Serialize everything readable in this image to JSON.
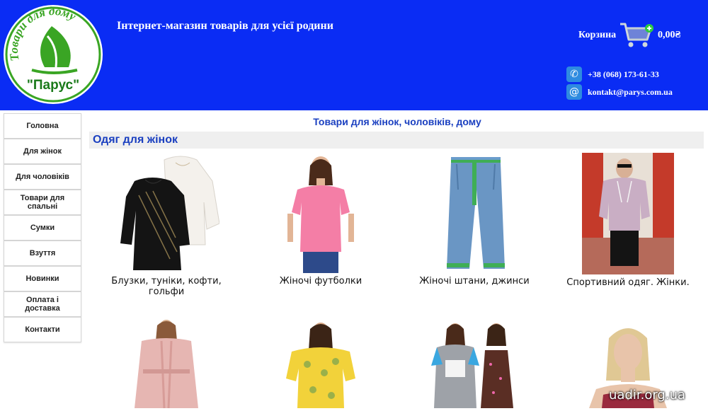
{
  "header": {
    "logo_arc_text": "Товари для дому",
    "logo_name": "\"Парус\"",
    "tagline": "Інтернет-магазин товарів для усієї родини",
    "cart": {
      "label": "Корзина",
      "amount": "0,00₴"
    },
    "phone": "+38 (068) 173-61-33",
    "email": "kontakt@parys.com.ua"
  },
  "sidebar": {
    "items": [
      {
        "label": "Головна"
      },
      {
        "label": "Для жінок"
      },
      {
        "label": "Для чоловіків"
      },
      {
        "label": "Товари для спальні"
      },
      {
        "label": "Сумки"
      },
      {
        "label": "Взуття"
      },
      {
        "label": "Новинки"
      },
      {
        "label": "Оплата і доставка"
      },
      {
        "label": "Контакти"
      }
    ]
  },
  "main": {
    "heading": "Товари для жінок, чоловіків, дому",
    "section_title": "Одяг для жінок",
    "products": [
      {
        "caption": "Блузки, туніки, кофти, гольфи"
      },
      {
        "caption": "Жіночі футболки"
      },
      {
        "caption": "Жіночі штани, джинси"
      },
      {
        "caption": "Спортивний одяг. Жінки."
      },
      {
        "caption": ""
      },
      {
        "caption": ""
      },
      {
        "caption": ""
      },
      {
        "caption": ""
      }
    ]
  },
  "watermark": "uadir.org.ua",
  "colors": {
    "header_bg": "#0a2cf4",
    "heading_blue": "#1a3fc0",
    "logo_green": "#3aa524"
  }
}
